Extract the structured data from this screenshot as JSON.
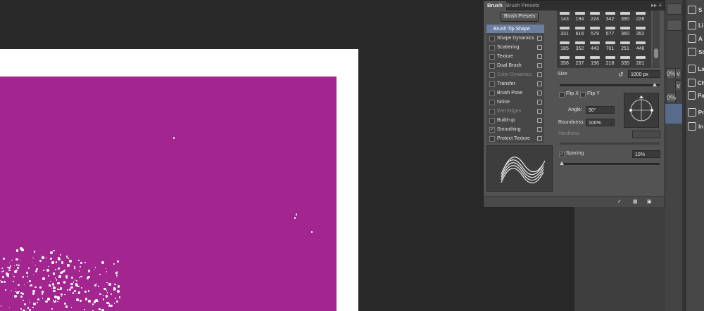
{
  "panel": {
    "tabs": [
      {
        "label": "Brush",
        "active": true
      },
      {
        "label": "Brush Presets",
        "active": false
      }
    ],
    "presets_button": "Brush Presets",
    "options": [
      {
        "name": "Brush Tip Shape",
        "selected": true,
        "checkbox": false,
        "lock": false,
        "dim": false
      },
      {
        "name": "Shape Dynamics",
        "selected": false,
        "checked": false,
        "lock": true,
        "dim": false
      },
      {
        "name": "Scattering",
        "selected": false,
        "checked": false,
        "lock": true,
        "dim": false
      },
      {
        "name": "Texture",
        "selected": false,
        "checked": false,
        "lock": true,
        "dim": false
      },
      {
        "name": "Dual Brush",
        "selected": false,
        "checked": false,
        "lock": true,
        "dim": false
      },
      {
        "name": "Color Dynamics",
        "selected": false,
        "checked": false,
        "lock": true,
        "dim": true
      },
      {
        "name": "Transfer",
        "selected": false,
        "checked": false,
        "lock": true,
        "dim": false
      },
      {
        "name": "Brush Pose",
        "selected": false,
        "checked": false,
        "lock": true,
        "dim": false
      },
      {
        "name": "Noise",
        "selected": false,
        "checked": false,
        "lock": true,
        "dim": false
      },
      {
        "name": "Wet Edges",
        "selected": false,
        "checked": false,
        "lock": true,
        "dim": true
      },
      {
        "name": "Build-up",
        "selected": false,
        "checked": false,
        "lock": true,
        "dim": false
      },
      {
        "name": "Smoothing",
        "selected": false,
        "checked": true,
        "lock": true,
        "dim": false
      },
      {
        "name": "Protect Texture",
        "selected": false,
        "checked": false,
        "lock": true,
        "dim": false
      }
    ],
    "preset_sizes": [
      [
        "143",
        "194",
        "224",
        "342",
        "390",
        "226"
      ],
      [
        "331",
        "616",
        "579",
        "577",
        "360",
        "352"
      ],
      [
        "185",
        "352",
        "443",
        "701",
        "251",
        "446"
      ],
      [
        "356",
        "237",
        "196",
        "218",
        "335",
        "281"
      ]
    ],
    "size_label": "Size",
    "size_value": "1000 px",
    "size_fraction": 0.95,
    "flip_x": "Flip X",
    "flip_y": "Flip Y",
    "angle_label": "Angle:",
    "angle_value": "90°",
    "roundness_label": "Roundness:",
    "roundness_value": "100%",
    "hardness_label": "Hardness",
    "spacing_label": "Spacing",
    "spacing_checked": true,
    "spacing_value": "10%",
    "spacing_fraction": 0.02
  },
  "dock_controls": {
    "v1": "v",
    "v2": "v",
    "pct1": "0%",
    "pct2": "0%"
  },
  "right_icons": [
    {
      "name": "styles-icon",
      "label": "S"
    },
    {
      "name": "libraries-icon",
      "label": "Li"
    },
    {
      "name": "adjustments-icon",
      "label": "A"
    },
    {
      "name": "styles2-icon",
      "label": "St"
    },
    {
      "name": "layers-icon",
      "label": "La"
    },
    {
      "name": "channels-icon",
      "label": "Ch"
    },
    {
      "name": "paths-icon",
      "label": "Pa"
    },
    {
      "name": "properties-icon",
      "label": "Pr"
    },
    {
      "name": "info-icon",
      "label": "In"
    }
  ],
  "colors": {
    "canvas_fill": "#a22590",
    "selection_blue": "#6c7fa3"
  }
}
